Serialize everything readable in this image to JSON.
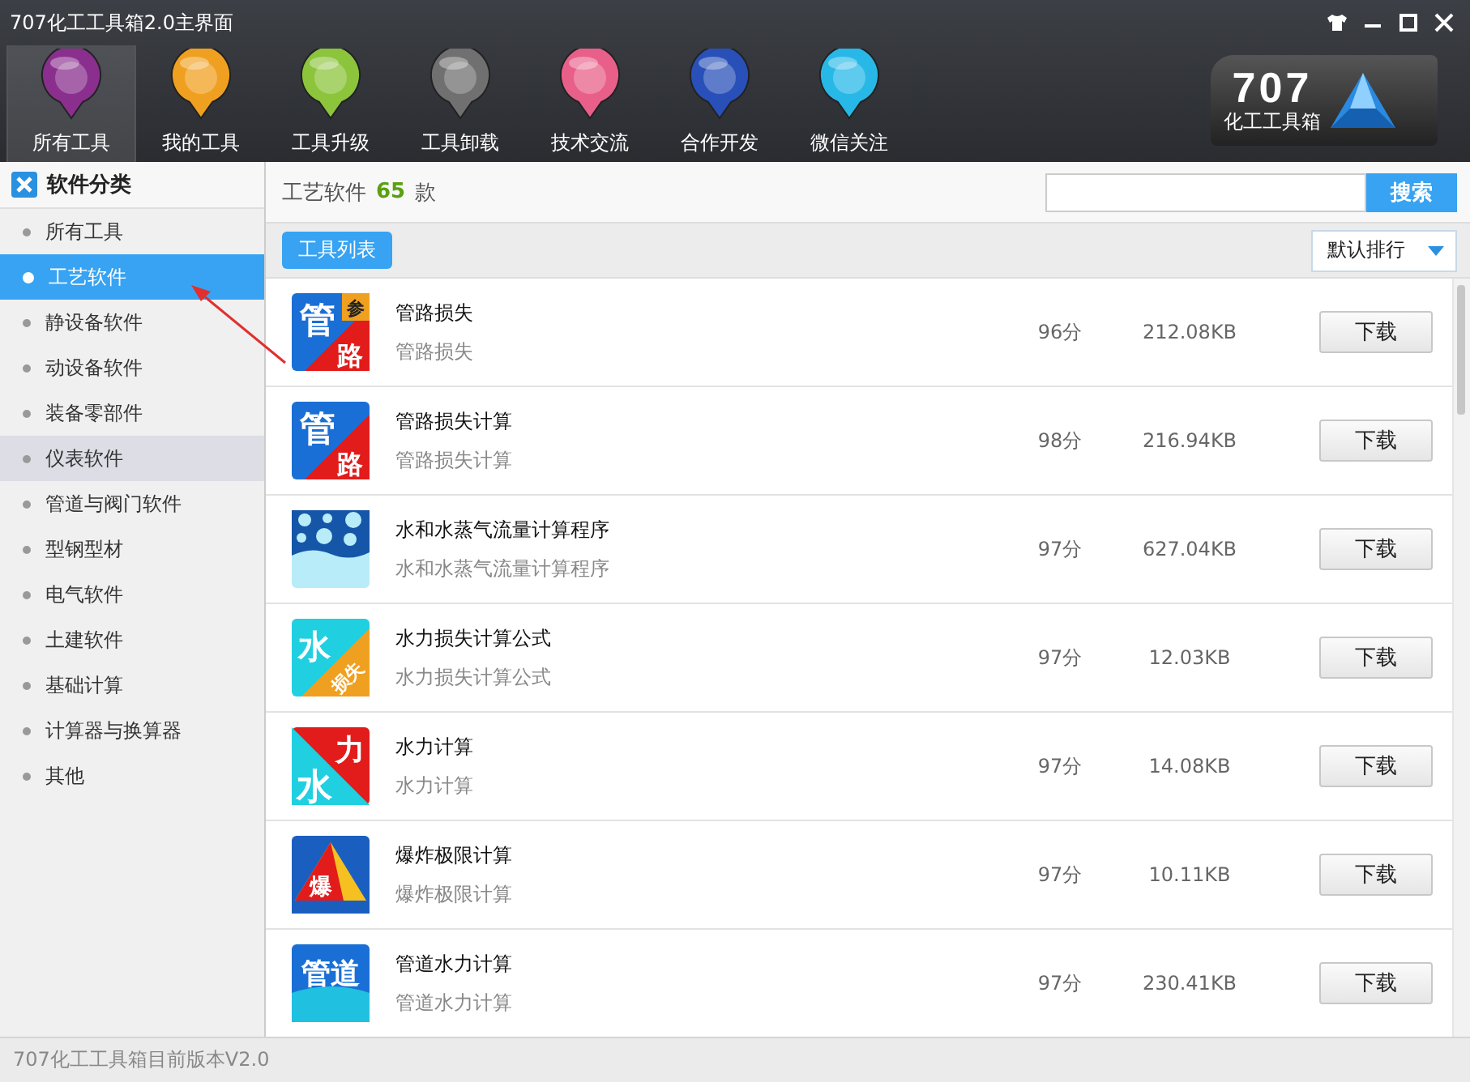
{
  "window": {
    "title": "707化工工具箱2.0主界面"
  },
  "toolbar": [
    {
      "label": "所有工具",
      "selected": true,
      "color": "#8a2f8e"
    },
    {
      "label": "我的工具",
      "selected": false,
      "color": "#f0a020"
    },
    {
      "label": "工具升级",
      "selected": false,
      "color": "#8cc43c"
    },
    {
      "label": "工具卸载",
      "selected": false,
      "color": "#707070"
    },
    {
      "label": "技术交流",
      "selected": false,
      "color": "#e8608a"
    },
    {
      "label": "合作开发",
      "selected": false,
      "color": "#2850b8"
    },
    {
      "label": "微信关注",
      "selected": false,
      "color": "#28b8e8"
    }
  ],
  "logo": {
    "number": "707",
    "name": "化工工具箱"
  },
  "sidebar": {
    "title": "软件分类",
    "items": [
      {
        "label": "所有工具",
        "selected": false,
        "highlighted": false
      },
      {
        "label": "工艺软件",
        "selected": true,
        "highlighted": false
      },
      {
        "label": "静设备软件",
        "selected": false,
        "highlighted": false
      },
      {
        "label": "动设备软件",
        "selected": false,
        "highlighted": false
      },
      {
        "label": "装备零部件",
        "selected": false,
        "highlighted": false
      },
      {
        "label": "仪表软件",
        "selected": false,
        "highlighted": true
      },
      {
        "label": "管道与阀门软件",
        "selected": false,
        "highlighted": false
      },
      {
        "label": "型钢型材",
        "selected": false,
        "highlighted": false
      },
      {
        "label": "电气软件",
        "selected": false,
        "highlighted": false
      },
      {
        "label": "土建软件",
        "selected": false,
        "highlighted": false
      },
      {
        "label": "基础计算",
        "selected": false,
        "highlighted": false
      },
      {
        "label": "计算器与换算器",
        "selected": false,
        "highlighted": false
      },
      {
        "label": "其他",
        "selected": false,
        "highlighted": false
      }
    ]
  },
  "header": {
    "category": "工艺软件",
    "count": "65",
    "unit": "款",
    "search": {
      "button": "搜索"
    }
  },
  "list_tab": "工具列表",
  "sort": {
    "value": "默认排行"
  },
  "rows": [
    {
      "name": "管路损失",
      "desc": "管路损失",
      "score": "96分",
      "size": "212.08KB",
      "button": "下载",
      "icon": {
        "kind": "pipe",
        "glyphs": [
          "管",
          "参",
          "路"
        ]
      }
    },
    {
      "name": "管路损失计算",
      "desc": "管路损失计算",
      "score": "98分",
      "size": "216.94KB",
      "button": "下载",
      "icon": {
        "kind": "pipe",
        "glyphs": [
          "管",
          "路"
        ]
      }
    },
    {
      "name": "水和水蒸气流量计算程序",
      "desc": "水和水蒸气流量计算程序",
      "score": "97分",
      "size": "627.04KB",
      "button": "下载",
      "icon": {
        "kind": "bubbles"
      }
    },
    {
      "name": "水力损失计算公式",
      "desc": "水力损失计算公式",
      "score": "97分",
      "size": "12.03KB",
      "button": "下载",
      "icon": {
        "kind": "water-loss",
        "glyphs": [
          "水",
          "损失"
        ]
      }
    },
    {
      "name": "水力计算",
      "desc": "水力计算",
      "score": "97分",
      "size": "14.08KB",
      "button": "下载",
      "icon": {
        "kind": "water-force",
        "glyphs": [
          "力",
          "水"
        ]
      }
    },
    {
      "name": "爆炸极限计算",
      "desc": "爆炸极限计算",
      "score": "97分",
      "size": "10.11KB",
      "button": "下载",
      "icon": {
        "kind": "explosion",
        "glyphs": [
          "爆"
        ]
      }
    },
    {
      "name": "管道水力计算",
      "desc": "管道水力计算",
      "score": "97分",
      "size": "230.41KB",
      "button": "下载",
      "icon": {
        "kind": "pipe-water",
        "glyphs": [
          "管道"
        ]
      }
    }
  ],
  "status_bar": "707化工工具箱目前版本V2.0"
}
